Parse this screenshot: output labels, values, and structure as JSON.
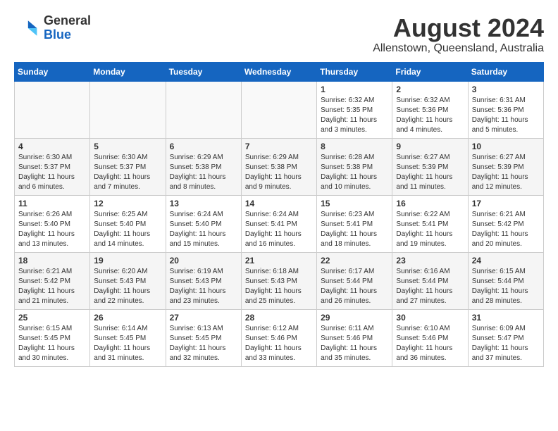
{
  "header": {
    "logo_general": "General",
    "logo_blue": "Blue",
    "title": "August 2024",
    "subtitle": "Allenstown, Queensland, Australia"
  },
  "calendar": {
    "days_of_week": [
      "Sunday",
      "Monday",
      "Tuesday",
      "Wednesday",
      "Thursday",
      "Friday",
      "Saturday"
    ],
    "weeks": [
      [
        {
          "day": "",
          "info": ""
        },
        {
          "day": "",
          "info": ""
        },
        {
          "day": "",
          "info": ""
        },
        {
          "day": "",
          "info": ""
        },
        {
          "day": "1",
          "info": "Sunrise: 6:32 AM\nSunset: 5:35 PM\nDaylight: 11 hours and 3 minutes."
        },
        {
          "day": "2",
          "info": "Sunrise: 6:32 AM\nSunset: 5:36 PM\nDaylight: 11 hours and 4 minutes."
        },
        {
          "day": "3",
          "info": "Sunrise: 6:31 AM\nSunset: 5:36 PM\nDaylight: 11 hours and 5 minutes."
        }
      ],
      [
        {
          "day": "4",
          "info": "Sunrise: 6:30 AM\nSunset: 5:37 PM\nDaylight: 11 hours and 6 minutes."
        },
        {
          "day": "5",
          "info": "Sunrise: 6:30 AM\nSunset: 5:37 PM\nDaylight: 11 hours and 7 minutes."
        },
        {
          "day": "6",
          "info": "Sunrise: 6:29 AM\nSunset: 5:38 PM\nDaylight: 11 hours and 8 minutes."
        },
        {
          "day": "7",
          "info": "Sunrise: 6:29 AM\nSunset: 5:38 PM\nDaylight: 11 hours and 9 minutes."
        },
        {
          "day": "8",
          "info": "Sunrise: 6:28 AM\nSunset: 5:38 PM\nDaylight: 11 hours and 10 minutes."
        },
        {
          "day": "9",
          "info": "Sunrise: 6:27 AM\nSunset: 5:39 PM\nDaylight: 11 hours and 11 minutes."
        },
        {
          "day": "10",
          "info": "Sunrise: 6:27 AM\nSunset: 5:39 PM\nDaylight: 11 hours and 12 minutes."
        }
      ],
      [
        {
          "day": "11",
          "info": "Sunrise: 6:26 AM\nSunset: 5:40 PM\nDaylight: 11 hours and 13 minutes."
        },
        {
          "day": "12",
          "info": "Sunrise: 6:25 AM\nSunset: 5:40 PM\nDaylight: 11 hours and 14 minutes."
        },
        {
          "day": "13",
          "info": "Sunrise: 6:24 AM\nSunset: 5:40 PM\nDaylight: 11 hours and 15 minutes."
        },
        {
          "day": "14",
          "info": "Sunrise: 6:24 AM\nSunset: 5:41 PM\nDaylight: 11 hours and 16 minutes."
        },
        {
          "day": "15",
          "info": "Sunrise: 6:23 AM\nSunset: 5:41 PM\nDaylight: 11 hours and 18 minutes."
        },
        {
          "day": "16",
          "info": "Sunrise: 6:22 AM\nSunset: 5:41 PM\nDaylight: 11 hours and 19 minutes."
        },
        {
          "day": "17",
          "info": "Sunrise: 6:21 AM\nSunset: 5:42 PM\nDaylight: 11 hours and 20 minutes."
        }
      ],
      [
        {
          "day": "18",
          "info": "Sunrise: 6:21 AM\nSunset: 5:42 PM\nDaylight: 11 hours and 21 minutes."
        },
        {
          "day": "19",
          "info": "Sunrise: 6:20 AM\nSunset: 5:43 PM\nDaylight: 11 hours and 22 minutes."
        },
        {
          "day": "20",
          "info": "Sunrise: 6:19 AM\nSunset: 5:43 PM\nDaylight: 11 hours and 23 minutes."
        },
        {
          "day": "21",
          "info": "Sunrise: 6:18 AM\nSunset: 5:43 PM\nDaylight: 11 hours and 25 minutes."
        },
        {
          "day": "22",
          "info": "Sunrise: 6:17 AM\nSunset: 5:44 PM\nDaylight: 11 hours and 26 minutes."
        },
        {
          "day": "23",
          "info": "Sunrise: 6:16 AM\nSunset: 5:44 PM\nDaylight: 11 hours and 27 minutes."
        },
        {
          "day": "24",
          "info": "Sunrise: 6:15 AM\nSunset: 5:44 PM\nDaylight: 11 hours and 28 minutes."
        }
      ],
      [
        {
          "day": "25",
          "info": "Sunrise: 6:15 AM\nSunset: 5:45 PM\nDaylight: 11 hours and 30 minutes."
        },
        {
          "day": "26",
          "info": "Sunrise: 6:14 AM\nSunset: 5:45 PM\nDaylight: 11 hours and 31 minutes."
        },
        {
          "day": "27",
          "info": "Sunrise: 6:13 AM\nSunset: 5:45 PM\nDaylight: 11 hours and 32 minutes."
        },
        {
          "day": "28",
          "info": "Sunrise: 6:12 AM\nSunset: 5:46 PM\nDaylight: 11 hours and 33 minutes."
        },
        {
          "day": "29",
          "info": "Sunrise: 6:11 AM\nSunset: 5:46 PM\nDaylight: 11 hours and 35 minutes."
        },
        {
          "day": "30",
          "info": "Sunrise: 6:10 AM\nSunset: 5:46 PM\nDaylight: 11 hours and 36 minutes."
        },
        {
          "day": "31",
          "info": "Sunrise: 6:09 AM\nSunset: 5:47 PM\nDaylight: 11 hours and 37 minutes."
        }
      ]
    ]
  }
}
